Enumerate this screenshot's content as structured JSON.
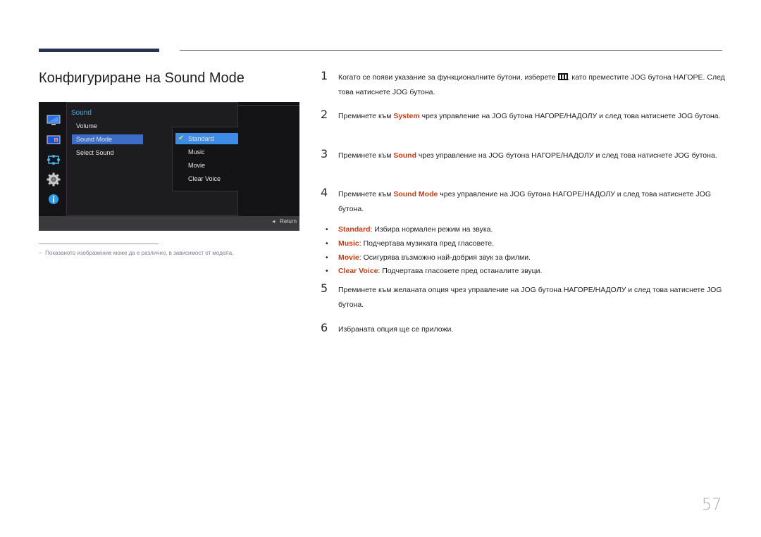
{
  "page": {
    "title": "Конфигуриране на Sound Mode",
    "page_number": "57",
    "footnote": "Показаното изображение може да е различно, в зависимост от модела.",
    "footnote_dash": "−"
  },
  "osd": {
    "section_title": "Sound",
    "menu_items": [
      {
        "label": "Volume",
        "selected": false
      },
      {
        "label": "Sound Mode",
        "selected": true
      },
      {
        "label": "Select Sound",
        "selected": false
      }
    ],
    "submenu_items": [
      {
        "label": "Standard",
        "selected": true
      },
      {
        "label": "Music",
        "selected": false
      },
      {
        "label": "Movie",
        "selected": false
      },
      {
        "label": "Clear Voice",
        "selected": false
      }
    ],
    "side_icons": [
      "monitor-icon",
      "picture-icon",
      "position-icon",
      "gear-icon",
      "info-icon"
    ],
    "return_label": "Return",
    "return_arrow": "◂",
    "check_glyph": "✔"
  },
  "steps": [
    {
      "num": "1",
      "pre": "Когато се появи указание за функционалните бутони, изберете ",
      "post": ", като преместите JOG бутона НАГОРЕ. След това натиснете JOG бутона."
    },
    {
      "num": "2",
      "pre": "Преминете към ",
      "hl": "System",
      "post": " чрез управление на JOG бутона НАГОРЕ/НАДОЛУ и след това натиснете JOG бутона."
    },
    {
      "num": "3",
      "pre": "Преминете към ",
      "hl": "Sound",
      "post": " чрез управление на JOG бутона НАГОРЕ/НАДОЛУ и след това натиснете JOG бутона."
    },
    {
      "num": "4",
      "pre": "Преминете към ",
      "hl": "Sound Mode",
      "post": " чрез управление на JOG бутона НАГОРЕ/НАДОЛУ и след това натиснете JOG бутона."
    },
    {
      "num": "5",
      "text": "Преминете към желаната опция чрез управление на JOG бутона НАГОРЕ/НАДОЛУ и след това натиснете JOG бутона."
    },
    {
      "num": "6",
      "text": "Избраната опция ще се приложи."
    }
  ],
  "bullets": [
    {
      "hl": "Standard",
      "text": ": Избира нормален режим на звука."
    },
    {
      "hl": "Music",
      "text": ": Подчертава музиката пред гласовете."
    },
    {
      "hl": "Movie",
      "text": ": Осигурява възможно най-добрия звук за филми."
    },
    {
      "hl": "Clear Voice",
      "text": ": Подчертава гласовете пред останалите звуци."
    }
  ],
  "bullet_glyph": "•",
  "colors": {
    "highlight": "#cc3a10",
    "osd_accent": "#3f8be8",
    "header_bar": "#28324f"
  }
}
